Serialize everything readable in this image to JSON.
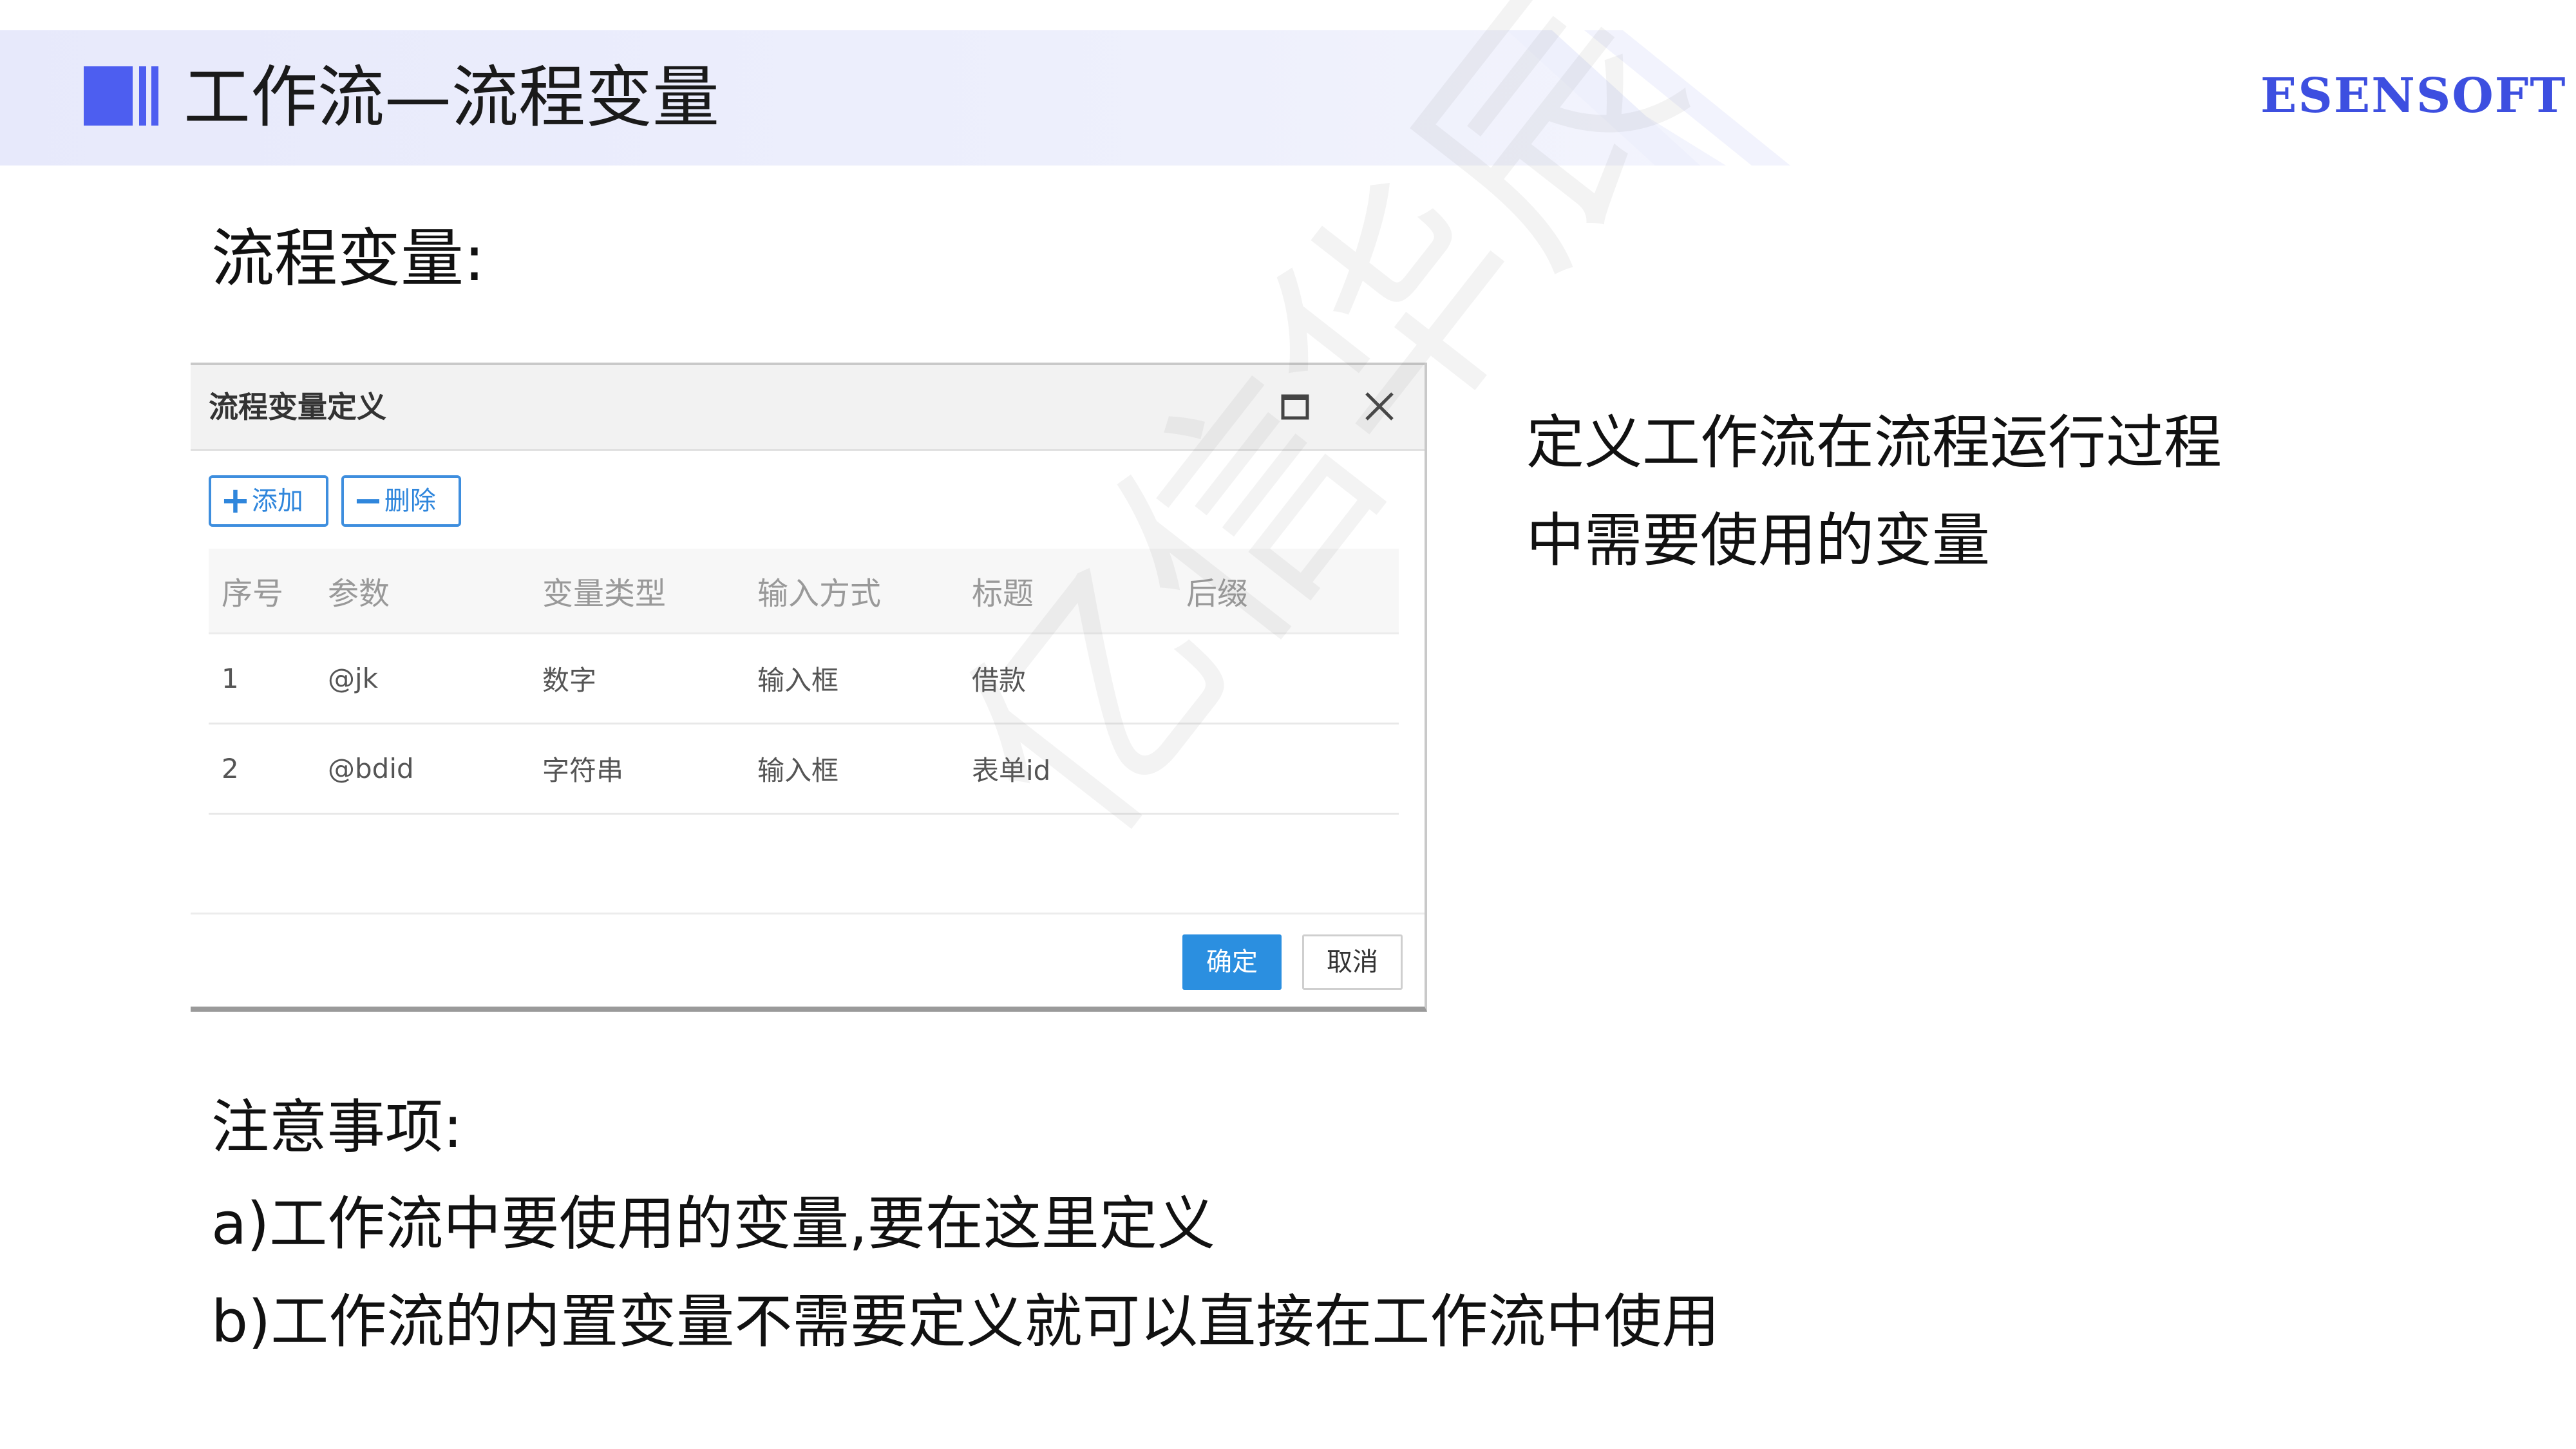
{
  "header": {
    "title": "工作流—流程变量",
    "brand": "ESENSOFT",
    "accent_color": "#4d5ef0"
  },
  "section_heading": "流程变量:",
  "dialog": {
    "title": "流程变量定义",
    "maximize_icon": "maximize-icon",
    "close_icon": "close-icon",
    "toolbar": {
      "add_label": "添加",
      "delete_label": "删除"
    },
    "table": {
      "columns": [
        "序号",
        "参数",
        "变量类型",
        "输入方式",
        "标题",
        "后缀"
      ],
      "rows": [
        [
          "1",
          "@jk",
          "数字",
          "输入框",
          "借款",
          ""
        ],
        [
          "2",
          "@bdid",
          "字符串",
          "输入框",
          "表单id",
          ""
        ]
      ]
    },
    "ok_label": "确定",
    "cancel_label": "取消",
    "ok_color": "#2b8fe0"
  },
  "description": {
    "line1": "定义工作流在流程运行过程",
    "line2": "中需要使用的变量"
  },
  "notes": {
    "heading": "注意事项:",
    "item_a": "a)工作流中要使用的变量,要在这里定义",
    "item_b": "b)工作流的内置变量不需要定义就可以直接在工作流中使用"
  },
  "watermark": "亿信华辰"
}
